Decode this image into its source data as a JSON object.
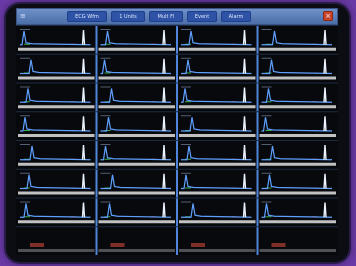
{
  "window": {
    "tabs": [
      {
        "label": "ECG Wfm"
      },
      {
        "label": "1 Units"
      },
      {
        "label": "Mult Fl"
      },
      {
        "label": "Event"
      },
      {
        "label": "Alarm"
      }
    ],
    "close_symbol": "×",
    "menu_symbol": "≡"
  },
  "monitor": {
    "columns": 4,
    "rows": 8,
    "colors": {
      "trace": "#5fa0ff",
      "spike": "#eef4ff",
      "baseline": "#d6d6d6",
      "separator": "#4f86d9",
      "grid_text": "#9fb7d9",
      "accent_red": "#d0473a",
      "accent_green": "#3fae4a"
    }
  }
}
